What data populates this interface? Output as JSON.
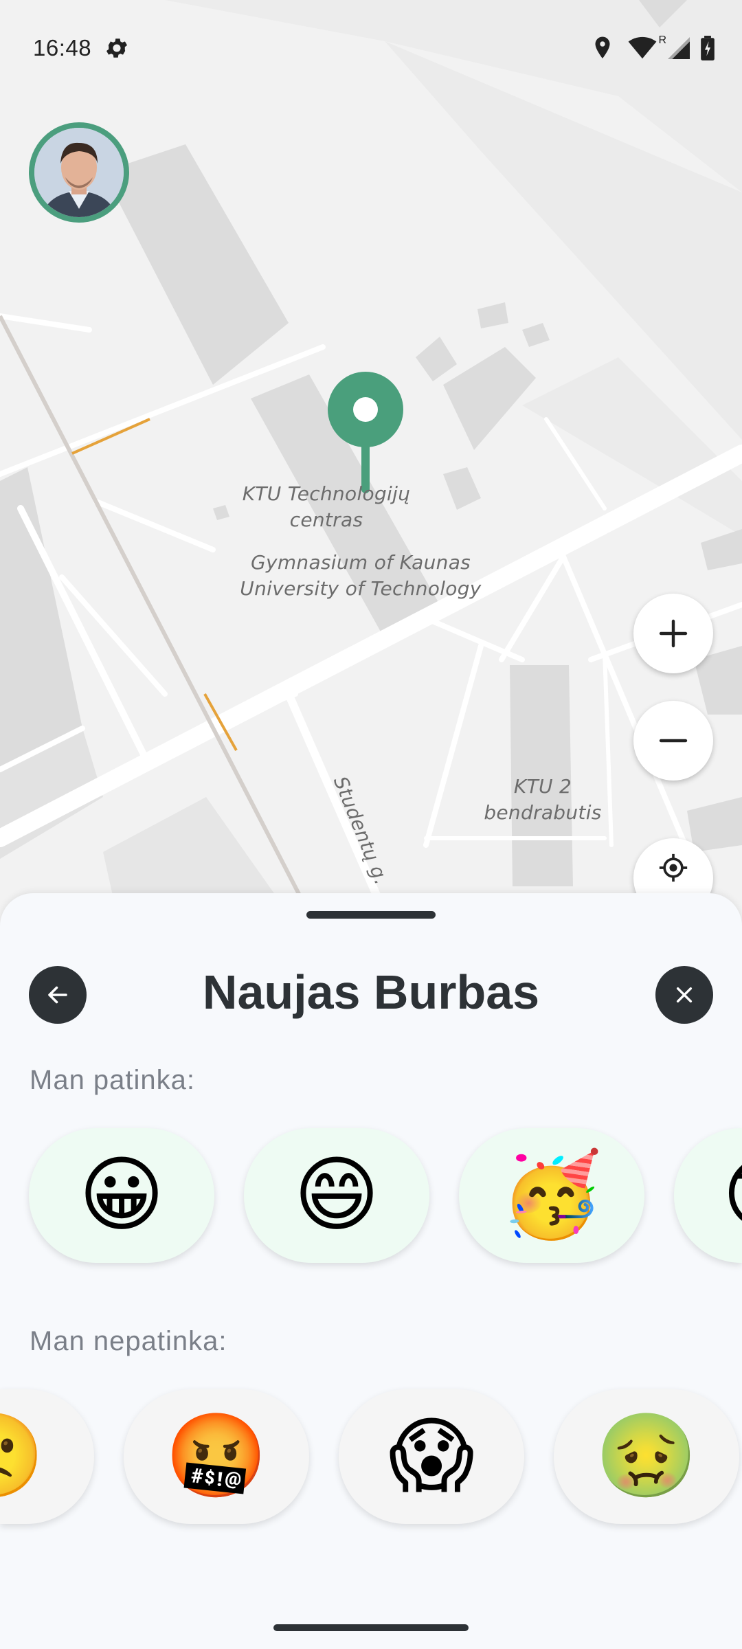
{
  "status_bar": {
    "time": "16:48",
    "icons": [
      "settings-icon",
      "location-icon",
      "wifi-icon",
      "cellular-icon",
      "battery-icon"
    ],
    "roaming_indicator": "R"
  },
  "map": {
    "labels": {
      "ktu_center": "KTU Technologijų\ncentras",
      "gymnasium": "Gymnasium of Kaunas\nUniversity of Technology",
      "dorm": "KTU 2 bendrabutis",
      "street": "Studentų g."
    },
    "colors": {
      "pin": "#4a9f7c",
      "highlight_road": "#e5a23a"
    },
    "controls": {
      "zoom_in_icon": "plus-icon",
      "zoom_out_icon": "minus-icon",
      "locate_icon": "locate-icon"
    }
  },
  "sheet": {
    "title": "Naujas Burbas",
    "back_icon": "arrow-left-icon",
    "close_icon": "close-icon",
    "likes_label": "Man patinka:",
    "dislikes_label": "Man nepatinka:",
    "likes": [
      {
        "emoji": "😀",
        "name": "grinning-face"
      },
      {
        "emoji": "😄",
        "name": "smiling-face-with-open-mouth-and-smiling-eyes"
      },
      {
        "emoji": "🥳",
        "name": "partying-face"
      },
      {
        "emoji": "😎",
        "name": "smiling-face-with-sunglasses"
      }
    ],
    "dislikes": [
      {
        "emoji": "🙁",
        "name": "frowning-face"
      },
      {
        "emoji": "🤬",
        "name": "face-with-symbols-on-mouth"
      },
      {
        "emoji": "😱",
        "name": "face-screaming-in-fear"
      },
      {
        "emoji": "🤢",
        "name": "nauseated-face"
      }
    ],
    "colors": {
      "like_bg": "#eefbf3",
      "dislike_bg": "#f5f5f5",
      "dark": "#2d3236"
    }
  }
}
